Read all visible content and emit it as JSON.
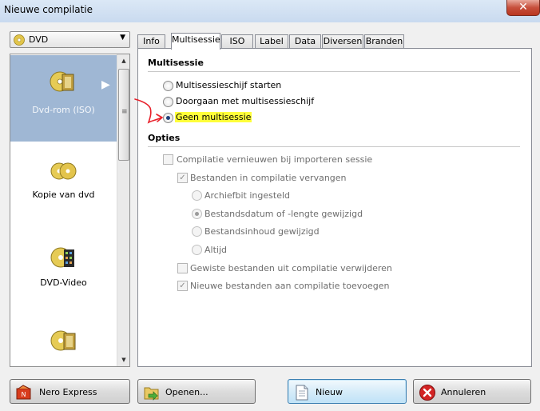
{
  "window": {
    "title": "Nieuwe compilatie",
    "close_glyph": "✕"
  },
  "dropdown": {
    "selected": "DVD",
    "icon": "disc-icon",
    "arrow": "▼"
  },
  "compilation_list": {
    "items": [
      {
        "label": "Dvd-rom (ISO)",
        "icon": "dvd-rom-disc-icon",
        "selected": true
      },
      {
        "label": "Kopie van dvd",
        "icon": "copy-disc-icon",
        "selected": false
      },
      {
        "label": "DVD-Video",
        "icon": "dvd-video-disc-icon",
        "selected": false
      },
      {
        "label": "",
        "icon": "dvd-disc-icon",
        "selected": false
      }
    ],
    "selected_arrow": "▶"
  },
  "tabs": [
    {
      "label": "Info",
      "active": false
    },
    {
      "label": "Multisessie",
      "active": true
    },
    {
      "label": "ISO",
      "active": false
    },
    {
      "label": "Label",
      "active": false
    },
    {
      "label": "Data",
      "active": false
    },
    {
      "label": "Diversen",
      "active": false
    },
    {
      "label": "Branden",
      "active": false
    }
  ],
  "multisessie": {
    "title": "Multisessie",
    "options": [
      {
        "label": "Multisessieschijf starten",
        "checked": false
      },
      {
        "label": "Doorgaan met multisessieschijf",
        "checked": false
      },
      {
        "label": "Geen multisessie",
        "checked": true,
        "highlight_color": "#ffff3a"
      }
    ]
  },
  "opties": {
    "title": "Opties",
    "renew": {
      "label": "Compilatie vernieuwen bij importeren sessie",
      "checked": false
    },
    "replace": {
      "label": "Bestanden in compilatie vervangen",
      "checked": true
    },
    "replace_options": [
      {
        "label": "Archiefbit ingesteld",
        "checked": false
      },
      {
        "label": "Bestandsdatum of -lengte gewijzigd",
        "checked": true
      },
      {
        "label": "Bestandsinhoud gewijzigd",
        "checked": false
      },
      {
        "label": "Altijd",
        "checked": false
      }
    ],
    "delete": {
      "label": "Gewiste bestanden uit compilatie verwijderen",
      "checked": false
    },
    "add": {
      "label": "Nieuwe bestanden aan compilatie toevoegen",
      "checked": true
    }
  },
  "buttons": {
    "nero_express": "Nero Express",
    "open": "Openen...",
    "new": "Nieuw",
    "cancel": "Annuleren"
  },
  "checkmark": "✓",
  "annotation_color": "#e8202a"
}
